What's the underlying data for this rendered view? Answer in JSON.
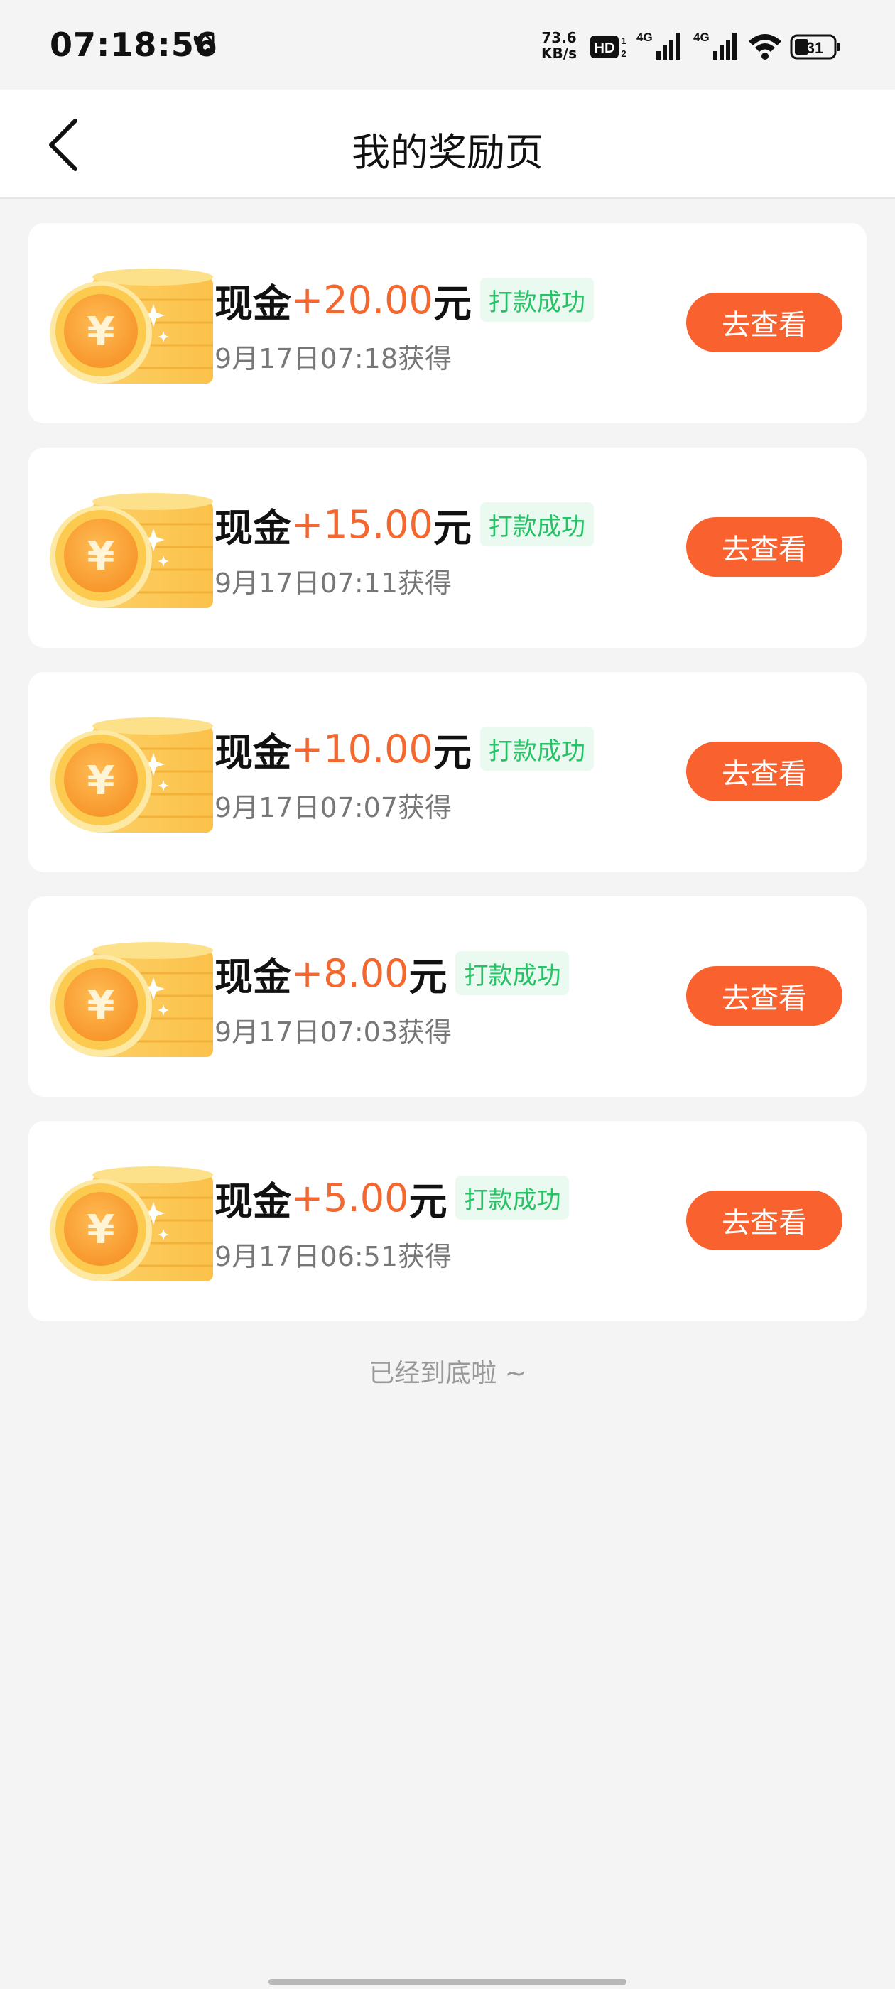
{
  "status_bar": {
    "time": "07:18:56",
    "net_speed_value": "73.6",
    "net_speed_unit": "KB/s",
    "hd_label": "HD",
    "signal1_label": "4G",
    "signal2_label": "4G",
    "battery": "31"
  },
  "header": {
    "title": "我的奖励页"
  },
  "rewards": [
    {
      "type": "现金",
      "amount": "+20.00",
      "unit": "元",
      "status": "打款成功",
      "time": "9月17日07:18获得",
      "button": "去查看"
    },
    {
      "type": "现金",
      "amount": "+15.00",
      "unit": "元",
      "status": "打款成功",
      "time": "9月17日07:11获得",
      "button": "去查看"
    },
    {
      "type": "现金",
      "amount": "+10.00",
      "unit": "元",
      "status": "打款成功",
      "time": "9月17日07:07获得",
      "button": "去查看"
    },
    {
      "type": "现金",
      "amount": "+8.00",
      "unit": "元",
      "status": "打款成功",
      "time": "9月17日07:03获得",
      "button": "去查看"
    },
    {
      "type": "现金",
      "amount": "+5.00",
      "unit": "元",
      "status": "打款成功",
      "time": "9月17日06:51获得",
      "button": "去查看"
    }
  ],
  "list_end_text": "已经到底啦 ~",
  "colors": {
    "accent": "#f9622f",
    "amount": "#f4682f",
    "status_text": "#27c266",
    "status_bg": "#eafaf0",
    "background": "#f4f4f4"
  },
  "icons": {
    "back": "back-arrow-icon",
    "coin": "gold-coin-stack-icon",
    "call": "call-icon",
    "wifi": "wifi-icon",
    "battery": "battery-icon"
  }
}
